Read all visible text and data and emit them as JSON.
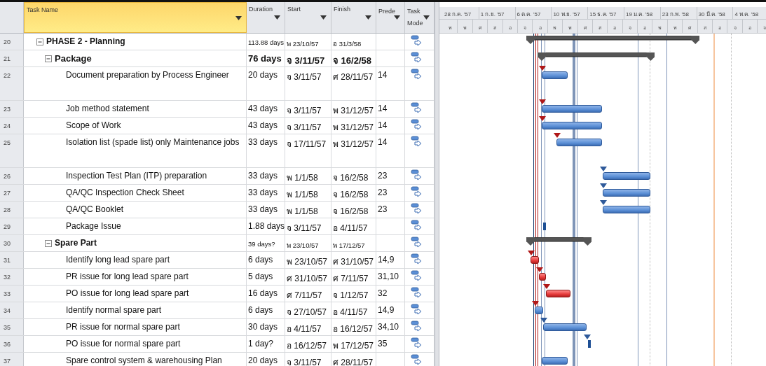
{
  "columns": [
    {
      "label": "Task Name",
      "selected": true
    },
    {
      "label": "Duration",
      "selected": false
    },
    {
      "label": "Start",
      "selected": false
    },
    {
      "label": "Finish",
      "selected": false
    },
    {
      "label": "Prede",
      "selected": false
    },
    {
      "label": "Task Mode",
      "selected": false
    }
  ],
  "timescale": {
    "major": [
      "28 ก.ค. '57",
      "1 ก.ย. '57",
      "6 ต.ค. '57",
      "10 พ.ย. '57",
      "15 ธ.ค. '57",
      "19 ม.ค. '58",
      "23 ก.พ. '58",
      "30 มี.ค. '58",
      "4 พ.ค. '58"
    ],
    "minor": [
      "พ",
      "พ",
      "ศ",
      "ส",
      "อ",
      "จ",
      "อ",
      "พ",
      "พ",
      "ศ",
      "ส",
      "อ",
      "จ",
      "อ",
      "พ",
      "พ",
      "ศ",
      "ส",
      "อ",
      "จ",
      "อ",
      "จ"
    ]
  },
  "rows": [
    {
      "id": "20",
      "name": "PHASE 2 -  Planning",
      "kind": "summary",
      "expanded": true,
      "bold_values": false,
      "duration": "113.88 days",
      "start": "พ 23/10/57",
      "finish": "อ 31/3/58",
      "bar": {
        "kind": "summary"
      },
      "children": [
        {
          "id": "21",
          "name": "Package",
          "kind": "summary",
          "expanded": true,
          "bold_values": true,
          "duration": "76 days",
          "start": "จ 3/11/57",
          "finish": "จ 16/2/58",
          "bar": {
            "kind": "summary"
          },
          "children": [
            {
              "id": "22",
              "name": "Document preparation by Process Engineer",
              "kind": "task",
              "tall": true,
              "duration": "20 days",
              "start": "จ 3/11/57",
              "finish": "ศ 28/11/57",
              "predecessors": "14",
              "bar": {
                "kind": "task",
                "critical_link": true
              }
            },
            {
              "id": "23",
              "name": "Job method statement",
              "kind": "task",
              "tall": false,
              "duration": "43 days",
              "start": "จ 3/11/57",
              "finish": "พ 31/12/57",
              "predecessors": "14",
              "bar": {
                "kind": "task",
                "critical_link": true
              }
            },
            {
              "id": "24",
              "name": "Scope of Work",
              "kind": "task",
              "tall": false,
              "duration": "43 days",
              "start": "จ 3/11/57",
              "finish": "พ 31/12/57",
              "predecessors": "14",
              "bar": {
                "kind": "task",
                "critical_link": true
              }
            },
            {
              "id": "25",
              "name": "Isolation list (spade list) only Maintenance jobs",
              "kind": "task",
              "tall": true,
              "duration": "33 days",
              "start": "จ 17/11/57",
              "finish": "พ 31/12/57",
              "predecessors": "14",
              "bar": {
                "kind": "task",
                "critical_link": true
              }
            },
            {
              "id": "26",
              "name": "Inspection Test Plan (ITP) preparation",
              "kind": "task",
              "tall": false,
              "duration": "33 days",
              "start": "พ 1/1/58",
              "finish": "จ 16/2/58",
              "predecessors": "23",
              "bar": {
                "kind": "task",
                "critical_link": false
              }
            },
            {
              "id": "27",
              "name": "QA/QC Inspection Check Sheet",
              "kind": "task",
              "tall": false,
              "duration": "33 days",
              "start": "พ 1/1/58",
              "finish": "จ 16/2/58",
              "predecessors": "23",
              "bar": {
                "kind": "task",
                "critical_link": false
              }
            },
            {
              "id": "28",
              "name": "QA/QC Booklet",
              "kind": "task",
              "tall": false,
              "duration": "33 days",
              "start": "พ 1/1/58",
              "finish": "จ 16/2/58",
              "predecessors": "23",
              "bar": {
                "kind": "task",
                "critical_link": false
              }
            },
            {
              "id": "29",
              "name": "Package Issue",
              "kind": "task",
              "tall": false,
              "duration": "1.88 days",
              "start": "จ 3/11/57",
              "finish": "อ 4/11/57",
              "bar": {
                "kind": "marker"
              }
            }
          ]
        },
        {
          "id": "30",
          "name": "Spare Part",
          "kind": "summary",
          "expanded": true,
          "bold_values": false,
          "duration": "39 days?",
          "start": "พ 23/10/57",
          "finish": "พ 17/12/57",
          "bar": {
            "kind": "summary"
          },
          "children": [
            {
              "id": "31",
              "name": "Identify long lead spare part",
              "kind": "task",
              "tall": false,
              "duration": "6 days",
              "start": "พ 23/10/57",
              "finish": "ศ 31/10/57",
              "predecessors": "14,9",
              "bar": {
                "kind": "critical",
                "critical_link": true
              }
            },
            {
              "id": "32",
              "name": "PR issue for long lead spare part",
              "kind": "task",
              "tall": false,
              "duration": "5 days",
              "start": "ศ 31/10/57",
              "finish": "ศ 7/11/57",
              "predecessors": "31,10",
              "bar": {
                "kind": "critical",
                "critical_link": true
              }
            },
            {
              "id": "33",
              "name": "PO issue for long lead spare part",
              "kind": "task",
              "tall": false,
              "duration": "16 days",
              "start": "ศ 7/11/57",
              "finish": "จ 1/12/57",
              "predecessors": "32",
              "bar": {
                "kind": "critical",
                "critical_link": true
              }
            },
            {
              "id": "34",
              "name": "Identify normal spare part",
              "kind": "task",
              "tall": false,
              "duration": "6 days",
              "start": "จ 27/10/57",
              "finish": "อ 4/11/57",
              "predecessors": "14,9",
              "bar": {
                "kind": "task",
                "critical_link": true
              }
            },
            {
              "id": "35",
              "name": "PR issue for normal spare part",
              "kind": "task",
              "tall": false,
              "duration": "30 days",
              "start": "อ 4/11/57",
              "finish": "อ 16/12/57",
              "predecessors": "34,10",
              "bar": {
                "kind": "task",
                "critical_link": false
              }
            },
            {
              "id": "36",
              "name": "PO issue for normal spare part",
              "kind": "task",
              "tall": false,
              "duration": "1 day?",
              "start": "อ 16/12/57",
              "finish": "พ 17/12/57",
              "predecessors": "35",
              "bar": {
                "kind": "marker",
                "critical_link": false
              }
            },
            {
              "id": "37",
              "name": "Spare control system & warehousing Plan",
              "kind": "task",
              "tall": false,
              "duration": "20 days",
              "start": "จ 3/11/57",
              "finish": "ศ 28/11/57",
              "bar": {
                "kind": "task"
              }
            }
          ]
        }
      ]
    }
  ]
}
